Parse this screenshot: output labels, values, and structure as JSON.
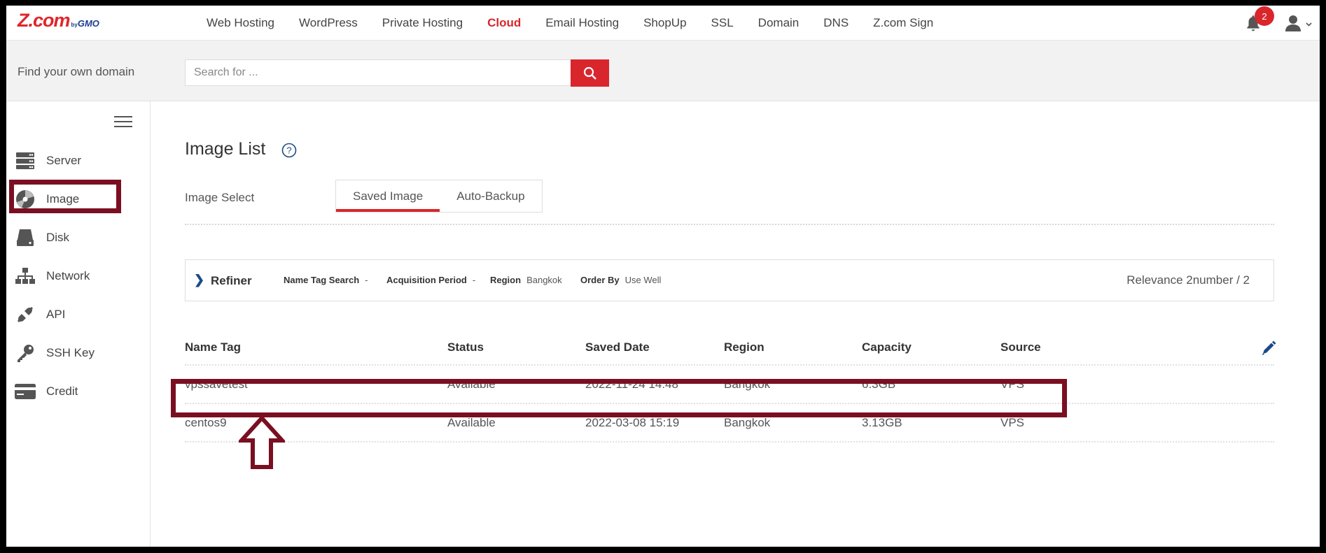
{
  "brand": {
    "logo_main": "Z.com",
    "logo_by": "by",
    "logo_gmo": "GMO",
    "accent_color": "#d9262c",
    "highlight_color": "#7b0f22"
  },
  "nav": {
    "items": [
      {
        "label": "Web Hosting"
      },
      {
        "label": "WordPress"
      },
      {
        "label": "Private Hosting"
      },
      {
        "label": "Cloud",
        "active": true
      },
      {
        "label": "Email Hosting"
      },
      {
        "label": "ShopUp"
      },
      {
        "label": "SSL"
      },
      {
        "label": "Domain"
      },
      {
        "label": "DNS"
      },
      {
        "label": "Z.com Sign"
      }
    ],
    "notification_count": "2"
  },
  "domain_search": {
    "label": "Find your own domain",
    "placeholder": "Search for ..."
  },
  "sidebar": {
    "items": [
      {
        "label": "Server",
        "icon": "server-icon"
      },
      {
        "label": "Image",
        "icon": "image-disc-icon",
        "selected": true
      },
      {
        "label": "Disk",
        "icon": "disk-icon"
      },
      {
        "label": "Network",
        "icon": "network-icon"
      },
      {
        "label": "API",
        "icon": "api-icon"
      },
      {
        "label": "SSH Key",
        "icon": "key-icon"
      },
      {
        "label": "Credit",
        "icon": "credit-card-icon"
      }
    ]
  },
  "main": {
    "title": "Image List",
    "image_select_label": "Image Select",
    "tabs": [
      {
        "label": "Saved Image",
        "active": true
      },
      {
        "label": "Auto-Backup"
      }
    ],
    "refiner": {
      "title": "Refiner",
      "name_tag_search": {
        "label": "Name Tag Search",
        "value": "-"
      },
      "acquisition_period": {
        "label": "Acquisition Period",
        "value": "-"
      },
      "region": {
        "label": "Region",
        "value": "Bangkok"
      },
      "order_by": {
        "label": "Order By",
        "value": "Use Well"
      },
      "relevance": "Relevance 2number / 2"
    },
    "table": {
      "headers": [
        "Name Tag",
        "Status",
        "Saved Date",
        "Region",
        "Capacity",
        "Source"
      ],
      "rows": [
        [
          "vpssavetest",
          "Available",
          "2022-11-24 14:48",
          "Bangkok",
          "6.3GB",
          "VPS"
        ],
        [
          "centos9",
          "Available",
          "2022-03-08 15:19",
          "Bangkok",
          "3.13GB",
          "VPS"
        ]
      ]
    }
  }
}
